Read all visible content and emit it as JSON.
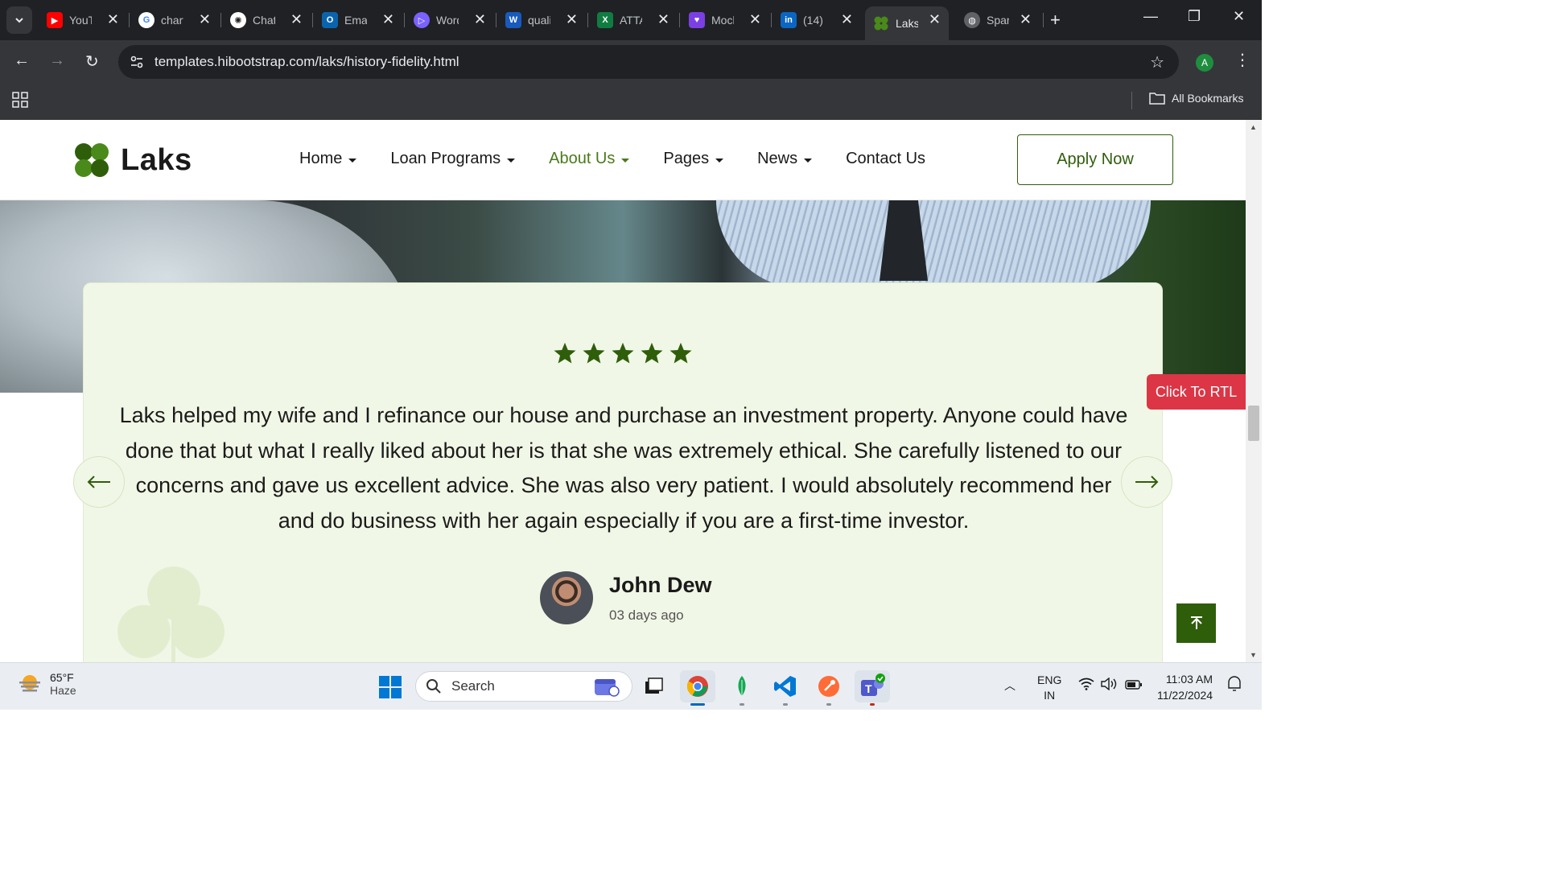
{
  "browser": {
    "tabs": [
      {
        "title": "YouTube",
        "icon": "youtube-icon",
        "color": "#ff0000"
      },
      {
        "title": "chart",
        "icon": "google-icon",
        "color": "#ffffff"
      },
      {
        "title": "ChatGPT",
        "icon": "chatgpt-icon",
        "color": "#ffffff"
      },
      {
        "title": "Email",
        "icon": "outlook-icon",
        "color": "#0a64ad"
      },
      {
        "title": "Word",
        "icon": "copilot-icon",
        "color": "#7b61ff"
      },
      {
        "title": "quality",
        "icon": "word-icon",
        "color": "#185abd"
      },
      {
        "title": "ATTA",
        "icon": "excel-icon",
        "color": "#107c41"
      },
      {
        "title": "Mock",
        "icon": "heart-chat-icon",
        "color": "#7b3fe4"
      },
      {
        "title": "(14)",
        "icon": "linkedin-icon",
        "color": "#0a66c2"
      },
      {
        "title": "Laks",
        "icon": "clover-icon",
        "color": "#4a8a1a",
        "active": true
      },
      {
        "title": "Spark",
        "icon": "globe-icon",
        "color": "#9aa0a6"
      }
    ],
    "url": "templates.hibootstrap.com/laks/history-fidelity.html",
    "profile_initial": "A",
    "bookmarks_label": "All Bookmarks"
  },
  "site": {
    "logo_text": "Laks",
    "nav": [
      {
        "label": "Home",
        "dropdown": true
      },
      {
        "label": "Loan Programs",
        "dropdown": true
      },
      {
        "label": "About Us",
        "dropdown": true,
        "active": true
      },
      {
        "label": "Pages",
        "dropdown": true
      },
      {
        "label": "News",
        "dropdown": true
      },
      {
        "label": "Contact Us",
        "dropdown": false
      }
    ],
    "cta": "Apply Now",
    "accent_color": "#2f5e0b",
    "rtl_button": "Click To RTL"
  },
  "testimonial": {
    "rating": 5,
    "quote": "Laks helped my wife and I refinance our house and purchase an investment property. Anyone could have done that but what I really liked about her is that she was extremely ethical. She carefully listened to our concerns and gave us excellent advice. She was also very patient. I would absolutely recommend her and do business with her again especially if you are a first-time investor.",
    "author_name": "John Dew",
    "author_time": "03 days ago"
  },
  "taskbar": {
    "weather_temp": "65°F",
    "weather_cond": "Haze",
    "search_placeholder": "Search",
    "lang_top": "ENG",
    "lang_bottom": "IN",
    "time": "11:03 AM",
    "date": "11/22/2024"
  }
}
